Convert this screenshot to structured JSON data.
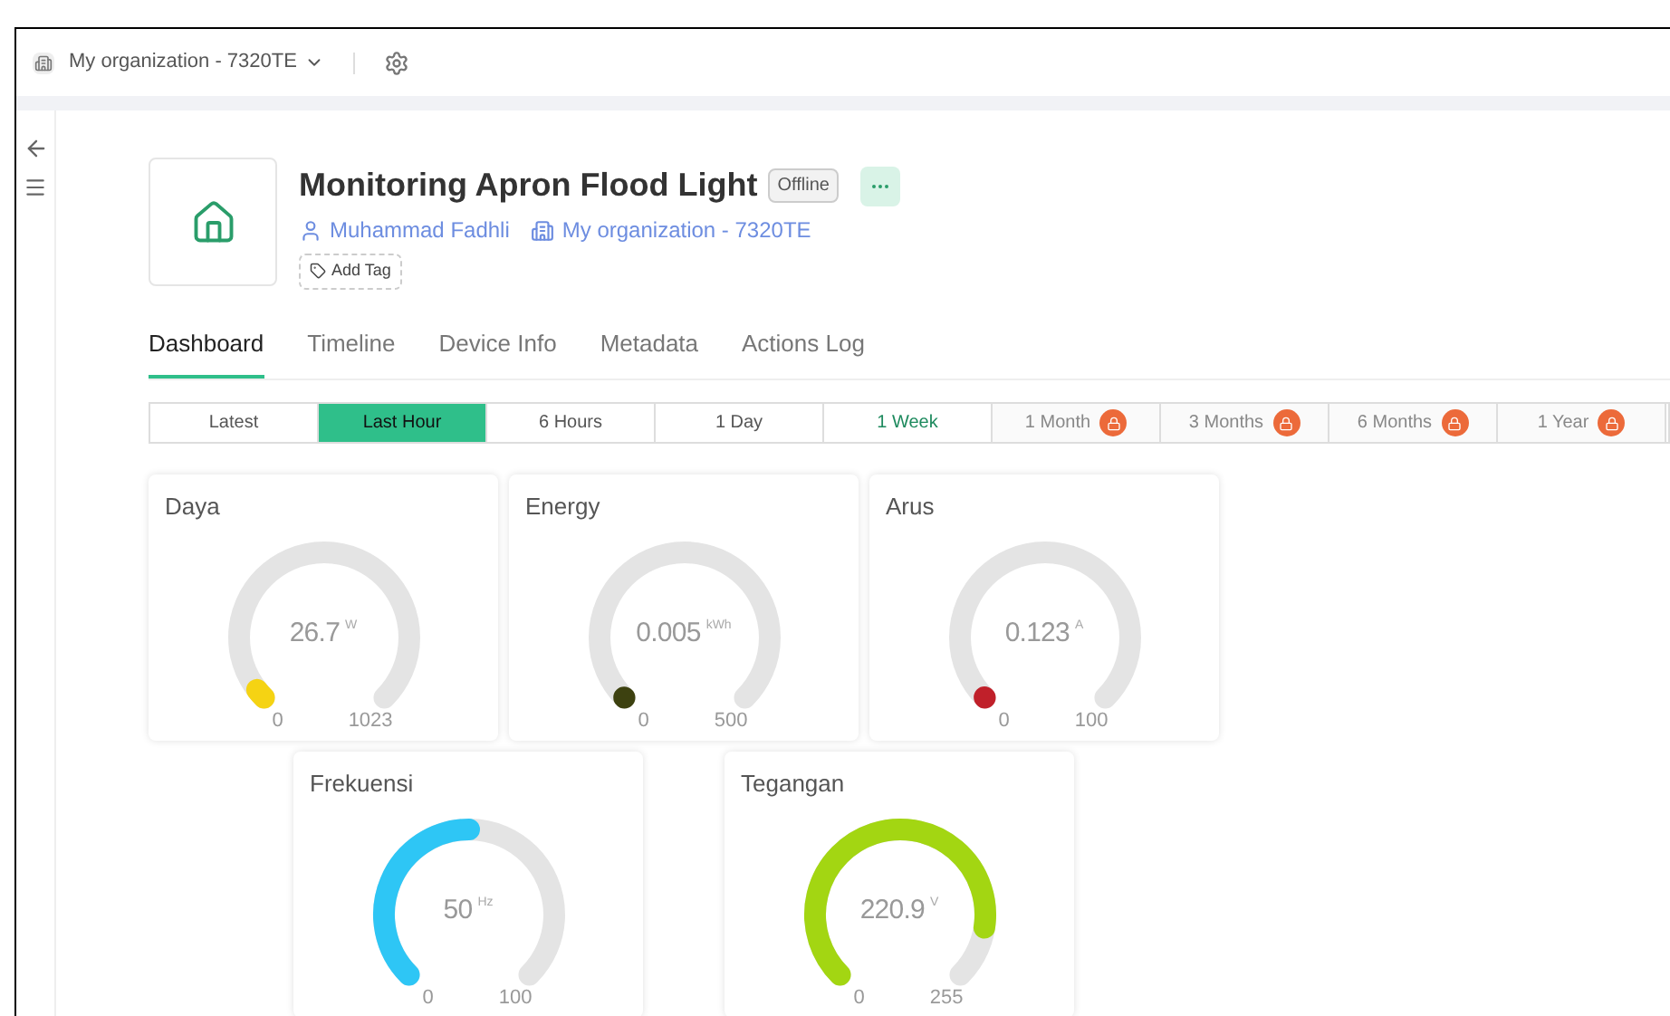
{
  "header": {
    "organization": "My organization - 7320TE"
  },
  "device": {
    "title": "Monitoring Apron Flood Light",
    "status": "Offline",
    "owner": "Muhammad Fadhli",
    "organization": "My organization - 7320TE",
    "add_tag": "Add Tag"
  },
  "tabs": [
    {
      "label": "Dashboard",
      "selected": true
    },
    {
      "label": "Timeline",
      "selected": false
    },
    {
      "label": "Device Info",
      "selected": false
    },
    {
      "label": "Metadata",
      "selected": false
    },
    {
      "label": "Actions Log",
      "selected": false
    }
  ],
  "ranges": [
    {
      "label": "Latest",
      "selected": false,
      "emphasized": false,
      "locked": false
    },
    {
      "label": "Last Hour",
      "selected": true,
      "emphasized": false,
      "locked": false
    },
    {
      "label": "6 Hours",
      "selected": false,
      "emphasized": false,
      "locked": false
    },
    {
      "label": "1 Day",
      "selected": false,
      "emphasized": false,
      "locked": false
    },
    {
      "label": "1 Week",
      "selected": false,
      "emphasized": true,
      "locked": false
    },
    {
      "label": "1 Month",
      "selected": false,
      "emphasized": false,
      "locked": true
    },
    {
      "label": "3 Months",
      "selected": false,
      "emphasized": false,
      "locked": true
    },
    {
      "label": "6 Months",
      "selected": false,
      "emphasized": false,
      "locked": true
    },
    {
      "label": "1 Year",
      "selected": false,
      "emphasized": false,
      "locked": true
    }
  ],
  "gauges": [
    {
      "title": "Daya",
      "value": "26.7",
      "unit": "W",
      "min": "0",
      "max": "1023",
      "color": "#f5d313"
    },
    {
      "title": "Energy",
      "value": "0.005",
      "unit": "kWh",
      "min": "0",
      "max": "500",
      "color": "#3d4110"
    },
    {
      "title": "Arus",
      "value": "0.123",
      "unit": "A",
      "min": "0",
      "max": "100",
      "color": "#c0202a"
    },
    {
      "title": "Frekuensi",
      "value": "50",
      "unit": "Hz",
      "min": "0",
      "max": "100",
      "color": "#2ec6f5"
    },
    {
      "title": "Tegangan",
      "value": "220.9",
      "unit": "V",
      "min": "0",
      "max": "255",
      "color": "#a3d612"
    }
  ]
}
